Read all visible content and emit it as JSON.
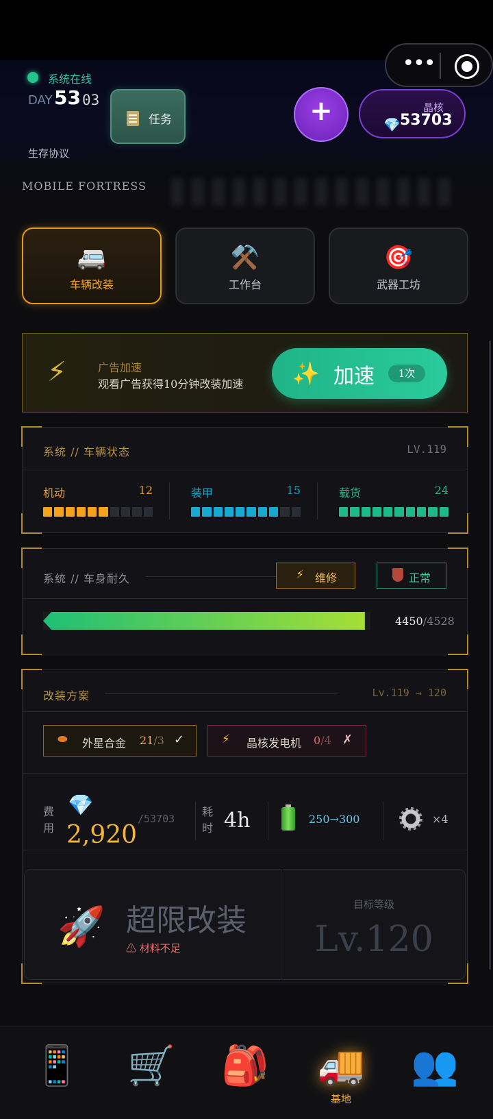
{
  "header": {
    "status_text": "系统在线",
    "day_label": "DAY",
    "day_number": "53",
    "day_sub": "03",
    "protocol_label": "生存协议",
    "task_button": "任务",
    "plus_button": "+",
    "crystal_label": "晶核",
    "crystal_value": "53703",
    "fortress_text": "MOBILE FORTRESS"
  },
  "tabs": [
    {
      "label": "车辆改装",
      "icon": "🚐",
      "active": true
    },
    {
      "label": "工作台",
      "icon": "⚒️",
      "active": false
    },
    {
      "label": "武器工坊",
      "icon": "🎯",
      "active": false
    }
  ],
  "ad": {
    "title": "广告加速",
    "description": "观看广告获得10分钟改装加速",
    "button_label": "加速",
    "button_count": "1次"
  },
  "vehicle_status": {
    "title": "系统 // 车辆状态",
    "level": "LV.119",
    "stats": [
      {
        "name": "机动",
        "value": "12",
        "filled": 6,
        "total": 10,
        "color": "#f2a21d"
      },
      {
        "name": "装甲",
        "value": "15",
        "filled": 8,
        "total": 10,
        "color": "#17a9cf"
      },
      {
        "name": "载货",
        "value": "24",
        "filled": 10,
        "total": 10,
        "color": "#1fb886"
      }
    ]
  },
  "durability": {
    "title": "系统 // 车身耐久",
    "repair_label": "维修",
    "status_label": "正常",
    "current": "4450",
    "max": "/4528",
    "fraction": 0.983
  },
  "modification": {
    "title": "改装方案",
    "level_range": "Lv.119 → 120",
    "materials": [
      {
        "name": "外星合金",
        "have": "21",
        "need": "/3",
        "mark": "✓"
      },
      {
        "name": "晶核发电机",
        "have": "0",
        "need": "/4",
        "mark": "✗"
      }
    ],
    "cost_label": "费用",
    "cost_value": "2,920",
    "cost_have": "/53703",
    "time_label": "耗时",
    "time_value": "4h",
    "power_value": "250→300",
    "gear_value": "×4",
    "ultra_title": "超限改装",
    "ultra_warning": "材料不足",
    "target_label": "目标等级",
    "target_value": "Lv.120"
  },
  "bottom_nav": [
    {
      "icon": "📱",
      "label": ""
    },
    {
      "icon": "🛒",
      "label": ""
    },
    {
      "icon": "🎒",
      "label": ""
    },
    {
      "icon": "🚚",
      "label": "基地"
    },
    {
      "icon": "👥",
      "label": ""
    }
  ]
}
